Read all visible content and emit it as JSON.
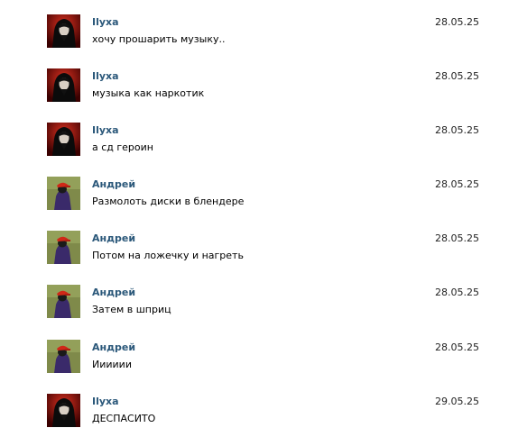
{
  "messages": [
    {
      "author": "Ilyxa",
      "avatar": "ilyxa-avatar",
      "text": "хочу прошарить музыку..",
      "date": "28.05.25"
    },
    {
      "author": "Ilyxa",
      "avatar": "ilyxa-avatar",
      "text": "музыка как наркотик",
      "date": "28.05.25"
    },
    {
      "author": "Ilyxa",
      "avatar": "ilyxa-avatar",
      "text": "а сд героин",
      "date": "28.05.25"
    },
    {
      "author": "Андрей",
      "avatar": "andrey-avatar",
      "text": "Размолоть диски в блендере",
      "date": "28.05.25"
    },
    {
      "author": "Андрей",
      "avatar": "andrey-avatar",
      "text": "Потом на ложечку и нагреть",
      "date": "28.05.25"
    },
    {
      "author": "Андрей",
      "avatar": "andrey-avatar",
      "text": "Затем в шприц",
      "date": "28.05.25"
    },
    {
      "author": "Андрей",
      "avatar": "andrey-avatar",
      "text": "Ииииии",
      "date": "28.05.25"
    },
    {
      "author": "Ilyxa",
      "avatar": "ilyxa-avatar",
      "text": "ДЕСПАСИТО",
      "date": "29.05.25"
    }
  ],
  "colors": {
    "author_link": "#2b587a",
    "text": "#000000",
    "background": "#ffffff"
  }
}
